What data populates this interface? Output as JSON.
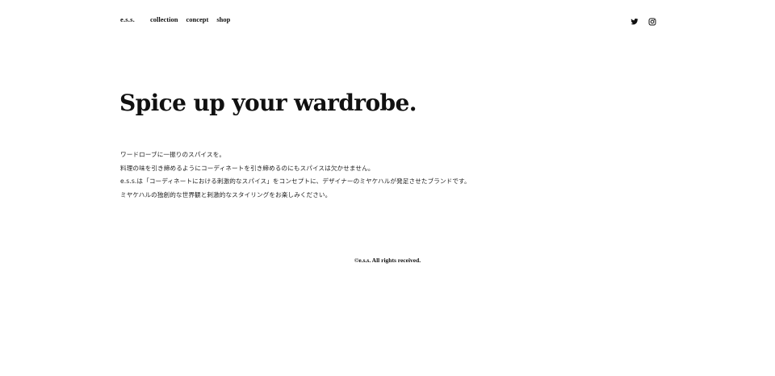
{
  "header": {
    "logo": "e.s.s.",
    "nav": [
      {
        "label": "collection"
      },
      {
        "label": "concept"
      },
      {
        "label": "shop"
      }
    ],
    "social": [
      {
        "icon": "twitter-icon"
      },
      {
        "icon": "instagram-icon"
      }
    ]
  },
  "hero": {
    "title": "Spice up your wardrobe."
  },
  "intro": {
    "lines": [
      "ワードローブに一振りのスパイスを。",
      "料理の味を引き締めるようにコーディネートを引き締めるのにもスパイスは欠かせません。",
      "e.s.s.は「コーディネートにおける刺激的なスパイス」をコンセプトに、デザイナーのミヤケハルが発足させたブランドです。",
      "ミヤケハルの独創的な世界観と刺激的なスタイリングをお楽しみください。"
    ]
  },
  "footer": {
    "copyright": "©e.s.s. All rights received."
  }
}
